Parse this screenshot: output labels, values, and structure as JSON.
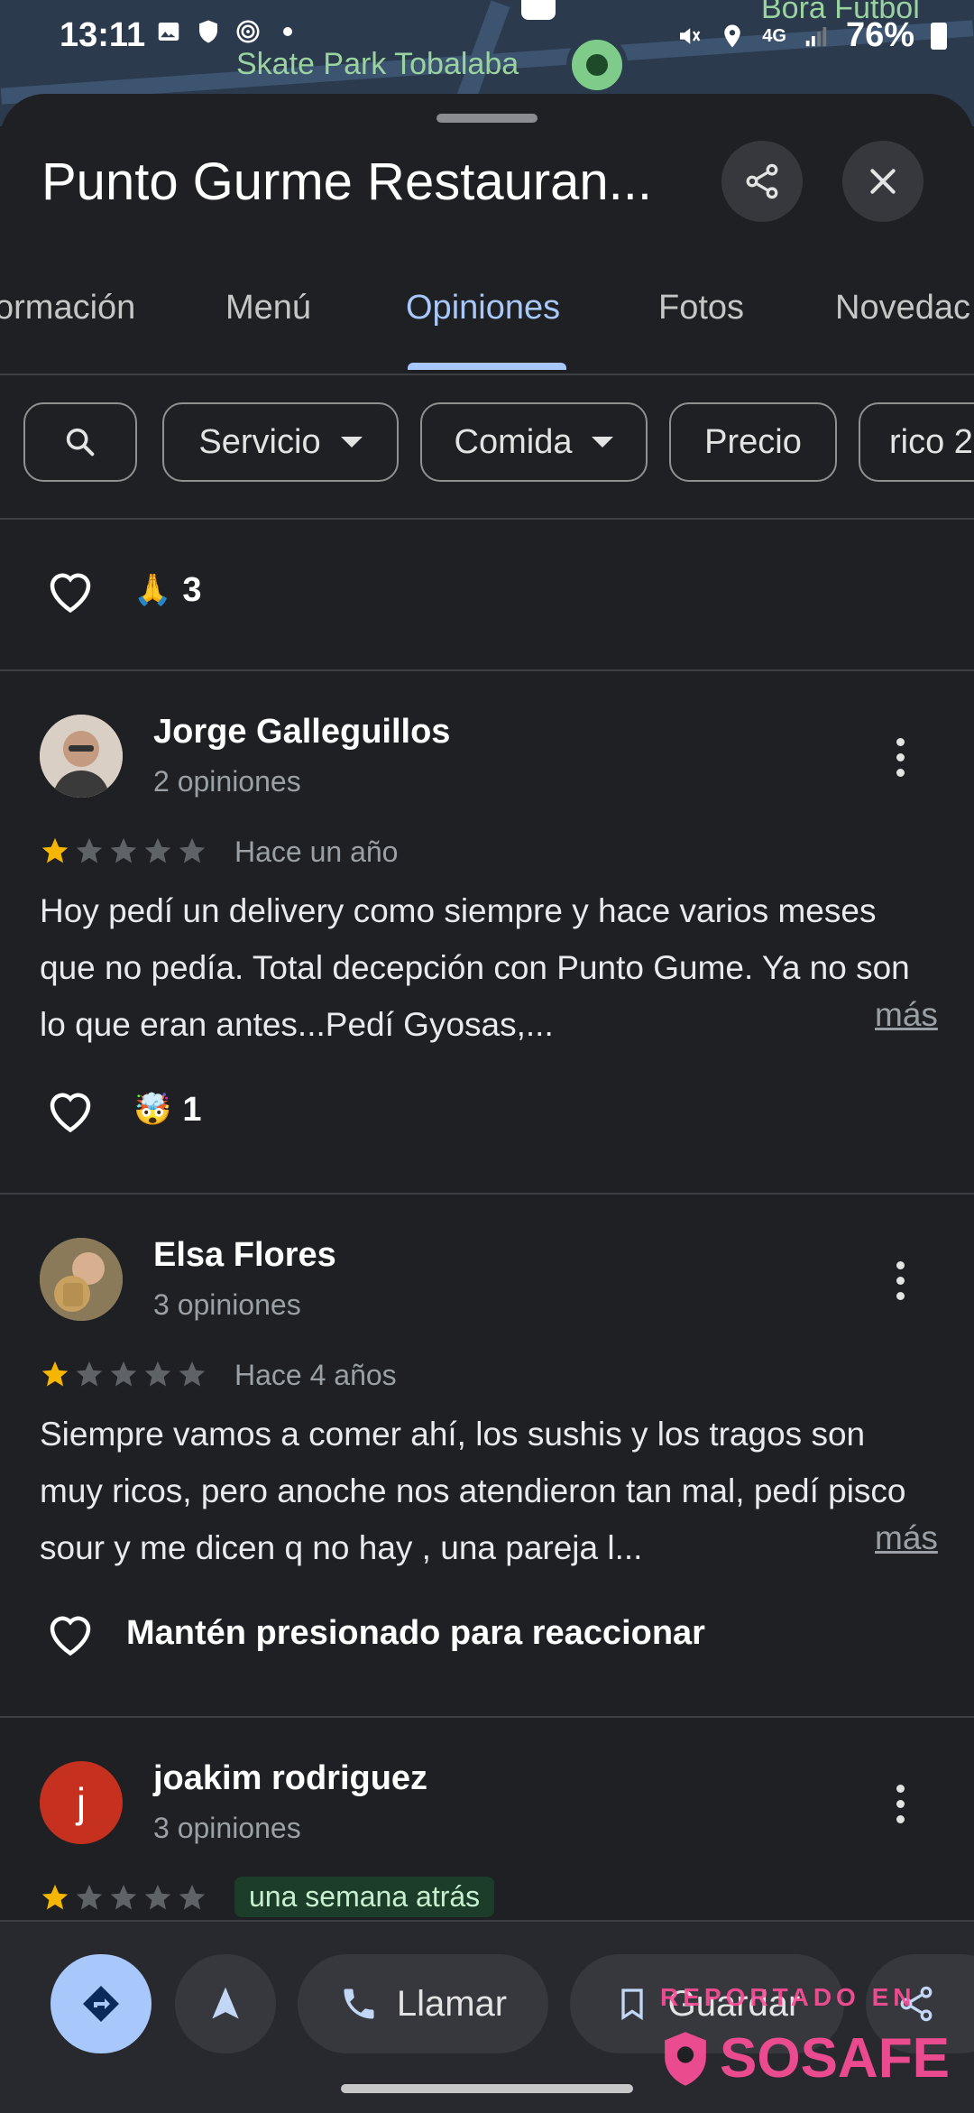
{
  "status_bar": {
    "time": "13:11",
    "battery": "76%",
    "network": "4G"
  },
  "map": {
    "labels": [
      "Skate Park Tobalaba",
      "Bora Fútbol"
    ]
  },
  "place": {
    "title": "Punto Gurme Restauran..."
  },
  "tabs": [
    {
      "label": "ormación"
    },
    {
      "label": "Menú"
    },
    {
      "label": "Opiniones",
      "active": true
    },
    {
      "label": "Fotos"
    },
    {
      "label": "Novedac"
    }
  ],
  "filters": {
    "chips": [
      {
        "label": "Servicio"
      },
      {
        "label": "Comida"
      },
      {
        "label": "Precio"
      },
      {
        "label": "rico 2"
      }
    ]
  },
  "top_reaction": {
    "emoji": "🙏",
    "count": "3"
  },
  "reviews": [
    {
      "name": "Jorge Galleguillos",
      "count": "2 opiniones",
      "rating": 1,
      "date": "Hace un año",
      "text": "Hoy pedí un delivery como siempre y hace varios meses que no pedía. Total decepción con Punto Gume. Ya no son lo que eran antes...Pedí Gyosas,...",
      "more": "más",
      "reaction_emoji": "🤯",
      "reaction_count": "1"
    },
    {
      "name": "Elsa Flores",
      "count": "3 opiniones",
      "rating": 1,
      "date": "Hace 4 años",
      "text": "Siempre vamos a comer ahí, los sushis y los tragos son muy ricos, pero anoche nos atendieron tan mal, pedí pisco sour y me dicen q no hay , una pareja l...",
      "more": "más",
      "reaction_hint": "Mantén presionado para reaccionar"
    },
    {
      "name": "joakim rodriguez",
      "initial": "j",
      "count": "3 opiniones",
      "rating": 1,
      "date": "una semana atrás"
    }
  ],
  "bottom_bar": {
    "call_label": "Llamar",
    "save_label": "Guardar"
  },
  "watermark": {
    "line1": "REPORTADO EN",
    "line2": "SOSAFE"
  },
  "colors": {
    "accent": "#a8c7fa",
    "star": "#f6b600",
    "background": "#1f2024"
  }
}
